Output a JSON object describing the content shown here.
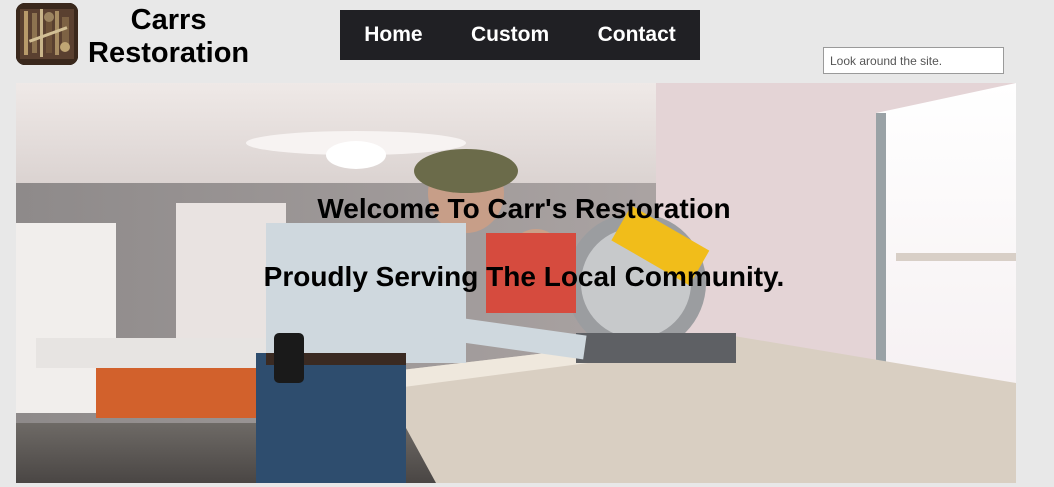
{
  "brand": {
    "name_line1": "Carrs",
    "name_line2": "Restoration",
    "logo_icon": "tools-logo-icon"
  },
  "nav": {
    "items": [
      {
        "label": "Home"
      },
      {
        "label": "Custom"
      },
      {
        "label": "Contact"
      }
    ]
  },
  "search": {
    "placeholder": "Look around the site."
  },
  "hero": {
    "heading": "Welcome To Carr's Restoration",
    "subheading": "Proudly Serving The Local Community."
  },
  "colors": {
    "page_bg": "#e8e8e8",
    "nav_bg": "#202024",
    "nav_text": "#ffffff"
  }
}
